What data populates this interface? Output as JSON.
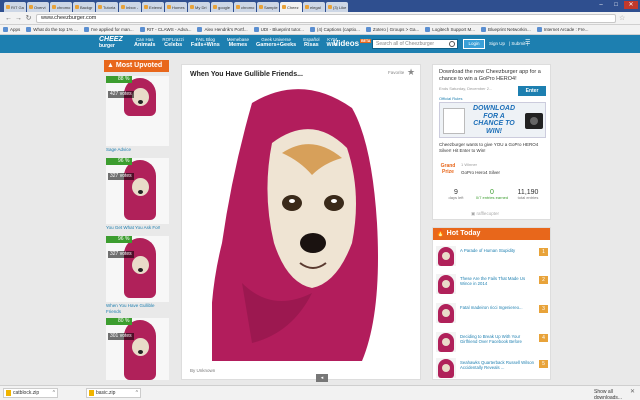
{
  "browser": {
    "tabs": [
      "RIT Ga",
      "Overvi",
      "chromo",
      "Backgr",
      "Tutoria",
      "Inbox -",
      "Extensi",
      "Homes",
      "My Dri",
      "google",
      "chromo",
      "Sample",
      "Cheez",
      "elegal",
      "(3) Like"
    ],
    "active_tab_index": 12,
    "url": "www.cheezburger.com",
    "bookmarks": [
      "Apps",
      "What do the top 1% ...",
      "I've applied for man...",
      "RIT - CLAWS - Adva...",
      "Alex Hendrik's Portf...",
      "UDI - Blueprint tutor...",
      "(4) Captions (captio...",
      "Zotero | Groups > Ga...",
      "Logitech Support M...",
      "Blueprint Networkin...",
      "Internet Arcade : Fre..."
    ]
  },
  "header": {
    "logo_line1": "CHEEZ",
    "logo_line2": "burger",
    "nav": [
      {
        "top": "Can Has",
        "bottom": "Animals"
      },
      {
        "top": "ROFLrazzi",
        "bottom": "Celebs"
      },
      {
        "top": "FAIL Blog",
        "bottom": "Fails+Wins"
      },
      {
        "top": "Memebase",
        "bottom": "Memes"
      },
      {
        "top": "Geek Universe",
        "bottom": "Gamers+Geeks"
      },
      {
        "top": "Español",
        "bottom": "Risas"
      },
      {
        "top": "KYM",
        "bottom": "Wiki"
      }
    ],
    "videos_label": "Videos",
    "videos_badge": "BETA",
    "search_placeholder": "Search all of Cheezburger",
    "login_label": "Login",
    "signup_label": "Sign Up",
    "submit_label": "| Submit |",
    "menu_glyph": "☰"
  },
  "most_upvoted": {
    "heading": "Most Upvoted",
    "items": [
      {
        "pct": "88 %",
        "votes": "427 votes",
        "title": "Sage Advice"
      },
      {
        "pct": "96 %",
        "votes": "327 votes",
        "title": "You Get What You Ask For!"
      },
      {
        "pct": "96 %",
        "votes": "327 votes",
        "title": "When You Have Gullible Friends"
      },
      {
        "pct": "80 %",
        "votes": "301 votes",
        "title": ""
      }
    ]
  },
  "post": {
    "title": "When You Have Gullible Friends...",
    "favorite_label": "Favorite",
    "byline": "By Unknown",
    "next_glyph": "◂"
  },
  "promo": {
    "title": "Download the new Cheezburger app for a chance to win a GoPro HERO4!",
    "ends": "Ends Saturday, December 2...",
    "rules": "Official Rules",
    "enter_label": "Enter",
    "banner_text": "DOWNLOAD FOR A CHANCE TO WIN!",
    "description": "Cheezburger wants to give YOU a GoPro HERO4 Silver! Hit Enter to Win!",
    "prize_label": "Grand Prize",
    "winner_label": "1 Winner",
    "prize_name": "GoPro Hero4 Silver",
    "stats": [
      {
        "value": "9",
        "label": "days left"
      },
      {
        "value": "0",
        "label": "0/7 entries earned"
      },
      {
        "value": "11,190",
        "label": "total entries"
      }
    ],
    "powered": "rafflecopter"
  },
  "hot_today": {
    "heading": "Hot Today",
    "items": [
      {
        "text": "A Parade of Human Stupidity",
        "rank": "1"
      },
      {
        "text": "These Are the Fails That Made Us Wince in 2014",
        "rank": "2"
      },
      {
        "text": "Fatal madeiron ricci Ingeniereo...",
        "rank": "3"
      },
      {
        "text": "Deciding to Break Up With Your Girlfriend Over Facebook Before",
        "rank": "4"
      },
      {
        "text": "Seahawks Quarterback Russell Wilson Accidentally Reveals ...",
        "rank": "5"
      }
    ]
  },
  "downloads": {
    "items": [
      "catblock.zip",
      "basic.zip"
    ],
    "show_all": "Show all downloads...",
    "close_glyph": "✕"
  },
  "colors": {
    "header_blue": "#1d7fb0",
    "accent_orange": "#e8671b",
    "hood_magenta": "#b0215a",
    "vote_green": "#3c9d2f"
  }
}
